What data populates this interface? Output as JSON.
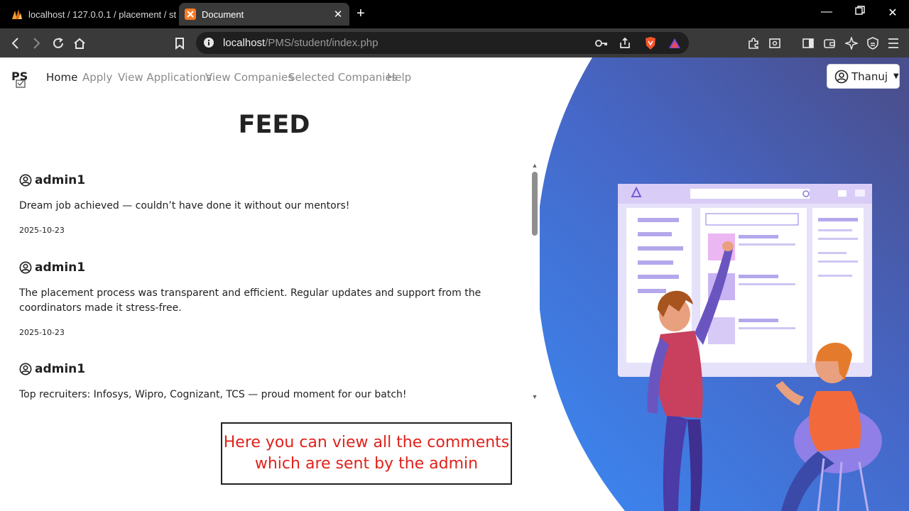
{
  "browser": {
    "tabs": [
      {
        "title": "localhost / 127.0.0.1 / placement / st",
        "active": false
      },
      {
        "title": "Document",
        "active": true
      }
    ],
    "new_tab": "+",
    "url_host": "localhost",
    "url_path": "/PMS/student/index.php"
  },
  "nav": {
    "brand": "PS",
    "links": [
      "Home",
      "Apply",
      "View Applications",
      "View Companies",
      "Selected Companies",
      "Help"
    ],
    "active": "Home"
  },
  "user": {
    "name": "Thanuj"
  },
  "feed": {
    "title": "FEED",
    "posts": [
      {
        "author": "admin1",
        "message": "Dream job achieved — couldn’t have done it without our mentors!",
        "date": "2025-10-23"
      },
      {
        "author": "admin1",
        "message": "The placement process was transparent and efficient. Regular updates and support from the coordinators made it stress-free.",
        "date": "2025-10-23"
      },
      {
        "author": "admin1",
        "message": "Top recruiters: Infosys, Wipro, Cognizant, TCS — proud moment for our batch!",
        "date": ""
      }
    ]
  },
  "annotation": {
    "line1": "Here you can view all the comments",
    "line2": "which are sent by the admin"
  },
  "colors": {
    "accent_blue": "#3f6fd8",
    "annotation_red": "#e0221b",
    "brave_orange": "#fb542b"
  }
}
